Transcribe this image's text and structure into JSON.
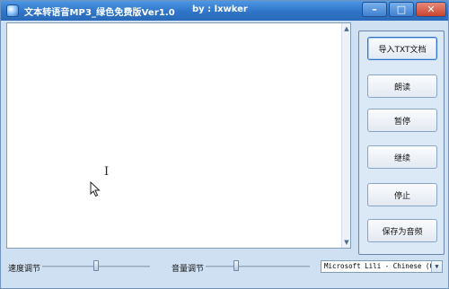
{
  "window": {
    "title": "文本转语音MP3_绿色免费版Ver1.0",
    "author": "by : lxwker",
    "controls": {
      "minimize": "–",
      "maximize": "□",
      "close": "✕"
    }
  },
  "text_area": {
    "content": ""
  },
  "buttons": {
    "import_txt": "导入TXT文档",
    "read_aloud": "朗读",
    "pause": "暂停",
    "resume": "继续",
    "stop": "停止",
    "save_audio": "保存为音频"
  },
  "controls": {
    "speed_label": "速度调节",
    "volume_label": "音量调节",
    "speed_level": 0.5,
    "volume_level": 0.5,
    "voice_selected": "Microsoft Lili - Chinese (Chi"
  },
  "icons": {
    "app": "app-icon",
    "ibeam": "text-cursor-icon",
    "arrow": "mouse-pointer-icon"
  }
}
